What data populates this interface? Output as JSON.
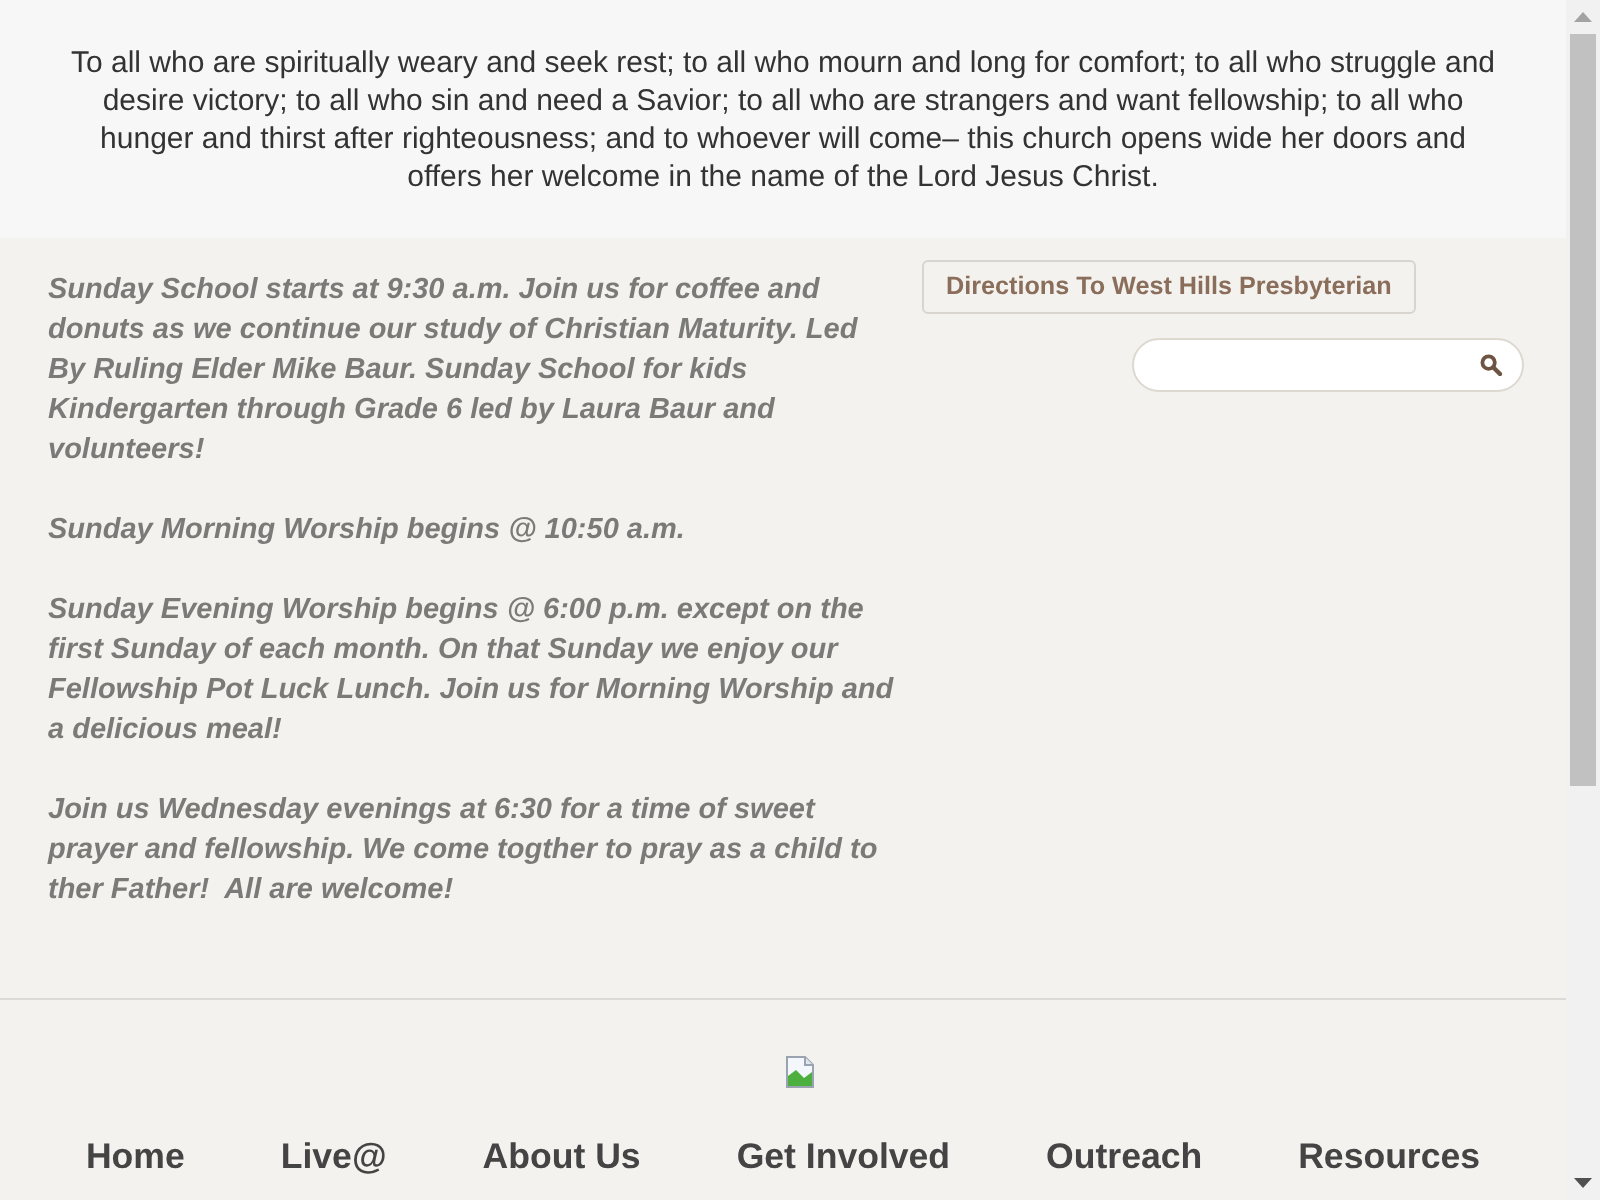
{
  "welcome_message": "To all who are spiritually weary and seek rest; to all who mourn and long for comfort; to all who struggle and desire victory; to all who sin and need a Savior; to all who are strangers and want fellowship; to all who hunger and thirst after righteousness; and to whoever will come– this church opens wide her doors and offers her welcome in the name of the Lord Jesus Christ.",
  "announcements": [
    "Sunday School starts at 9:30 a.m. Join us for coffee and donuts as we continue our study of Christian Maturity. Led By Ruling Elder Mike Baur. Sunday School for kids Kindergarten through Grade 6 led by Laura Baur and volunteers!",
    "Sunday Morning Worship begins @ 10:50 a.m.",
    "Sunday Evening Worship begins @ 6:00 p.m. except on the first Sunday of each month. On that Sunday we enjoy our Fellowship Pot Luck Lunch. Join us for Morning Worship and a delicious meal!",
    "Join us Wednesday evenings at 6:30 for a time of sweet prayer and fellowship. We come togther to pray as a child to ther Father!  All are welcome!"
  ],
  "directions_button": "Directions To West Hills Presbyterian",
  "footer_nav": [
    "Home",
    "Live@",
    "About Us",
    "Get Involved",
    "Outreach",
    "Resources"
  ]
}
